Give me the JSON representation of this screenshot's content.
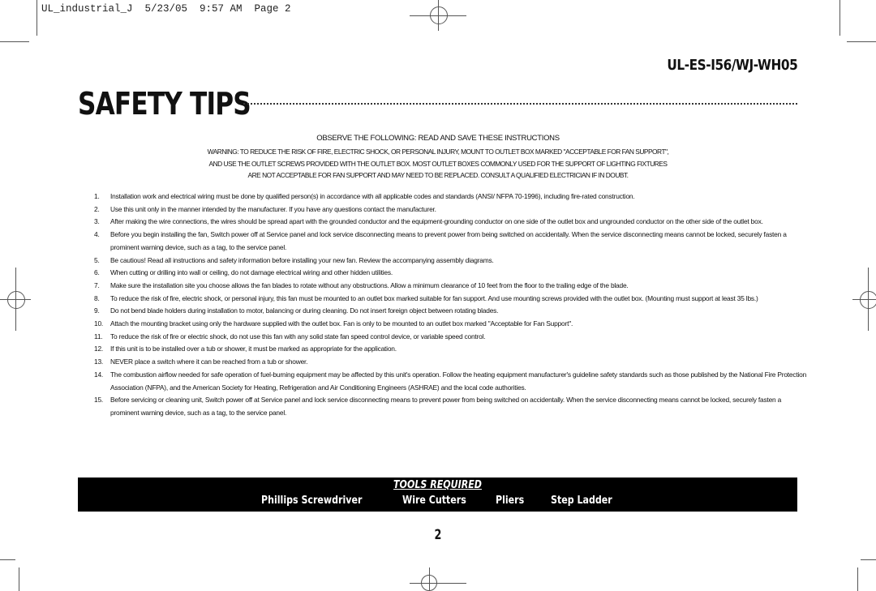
{
  "slug": "UL_industrial_J  5/23/05  9:57 AM  Page 2",
  "model": "UL-ES-I56/WJ-WH05",
  "title": "SAFETY TIPS",
  "observe": "OBSERVE THE FOLLOWING: READ AND SAVE THESE INSTRUCTIONS",
  "warning_lines": [
    "WARNING: TO REDUCE THE RISK OF FIRE, ELECTRIC SHOCK, OR PERSONAL INJURY, MOUNT TO OUTLET BOX MARKED \"ACCEPTABLE FOR FAN SUPPORT\",",
    "AND USE THE OUTLET SCREWS PROVIDED WITH THE OUTLET BOX. MOST OUTLET BOXES COMMONLY USED FOR THE SUPPORT OF LIGHTING FIXTURES",
    "ARE NOT ACCEPTABLE FOR FAN SUPPORT AND MAY NEED TO BE REPLACED. CONSULT A QUALIFIED ELECTRICIAN IF IN DOUBT."
  ],
  "tips": [
    {
      "num": "1.",
      "text": "Installation work and electrical wiring must be done by qualified person(s) in accordance with all applicable codes and standards (ANSI/ NFPA 70-1996), including fire-rated construction."
    },
    {
      "num": "2.",
      "text": "Use this unit only in the manner intended by the manufacturer.  If you have  any questions contact the manufacturer."
    },
    {
      "num": "3.",
      "text": "After making the wire connections, the wires should be spread apart with the grounded conductor and the equipment-grounding conductor on one side of the outlet box and ungrounded conductor on the other side of the outlet box."
    },
    {
      "num": "4.",
      "text": "Before you begin installing the fan, Switch power off at Service panel and lock service disconnecting means to prevent power from being switched on accidentally.  When the service disconnecting means cannot be locked, securely fasten a prominent warning device, such  as a tag, to the service panel."
    },
    {
      "num": "5.",
      "text": "Be cautious! Read all instructions and safety information before installing your new fan. Review the accompanying assembly diagrams."
    },
    {
      "num": "6.",
      "text": "When cutting or drilling into wall or ceiling, do not damage electrical wiring and other hidden utilities."
    },
    {
      "num": "7.",
      "text": "Make sure the installation site you choose allows the fan blades to rotate without any obstructions. Allow a minimum clearance of 10 feet from the floor to the trailing edge of the blade."
    },
    {
      "num": "8.",
      "text": "To reduce the risk of fire, electric shock, or personal injury, this fan must be mounted to an outlet box marked suitable for fan support.  And use mounting screws provided with the outlet box. (Mounting must support at least 35 lbs.)"
    },
    {
      "num": "9.",
      "text": "Do not bend blade holders during installation to motor, balancing or during cleaning.  Do not insert foreign object between rotating blades."
    },
    {
      "num": "10.",
      "text": "Attach the mounting bracket using only the hardware supplied with the outlet box. Fan is only to be mounted to an outlet box marked \"Acceptable for Fan Support\"."
    },
    {
      "num": "11.",
      "text": "To reduce the risk of fire or electric shock, do not use this fan with any solid state fan speed control device, or variable speed control."
    },
    {
      "num": "12.",
      "text": "If this unit is to be installed over a tub or shower, it must be marked as appropriate for the application."
    },
    {
      "num": "13.",
      "text": "NEVER place a switch where it can be reached from a tub or shower."
    },
    {
      "num": "14.",
      "text": "The combustion airflow needed for safe operation of fuel-burning equipment may be affected by this unit's operation. Follow the heating equipment manufacturer's guideline safety standards such as those published by the National Fire Protection Association (NFPA), and the American Society for Heating, Refrigeration and Air Conditioning Engineers (ASHRAE) and the local code authorities."
    },
    {
      "num": "15.",
      "text": "Before servicing or cleaning unit, Switch power off at Service panel and lock service disconnecting means to prevent power from being switched on accidentally.  When the service disconnecting means cannot be locked, securely fasten a prominent warning device, such  as a tag, to the service panel."
    }
  ],
  "tools": {
    "title": "TOOLS REQUIRED",
    "items": [
      "Phillips Screwdriver",
      "Wire Cutters",
      "Pliers",
      "Step Ladder"
    ]
  },
  "page_number": "2"
}
